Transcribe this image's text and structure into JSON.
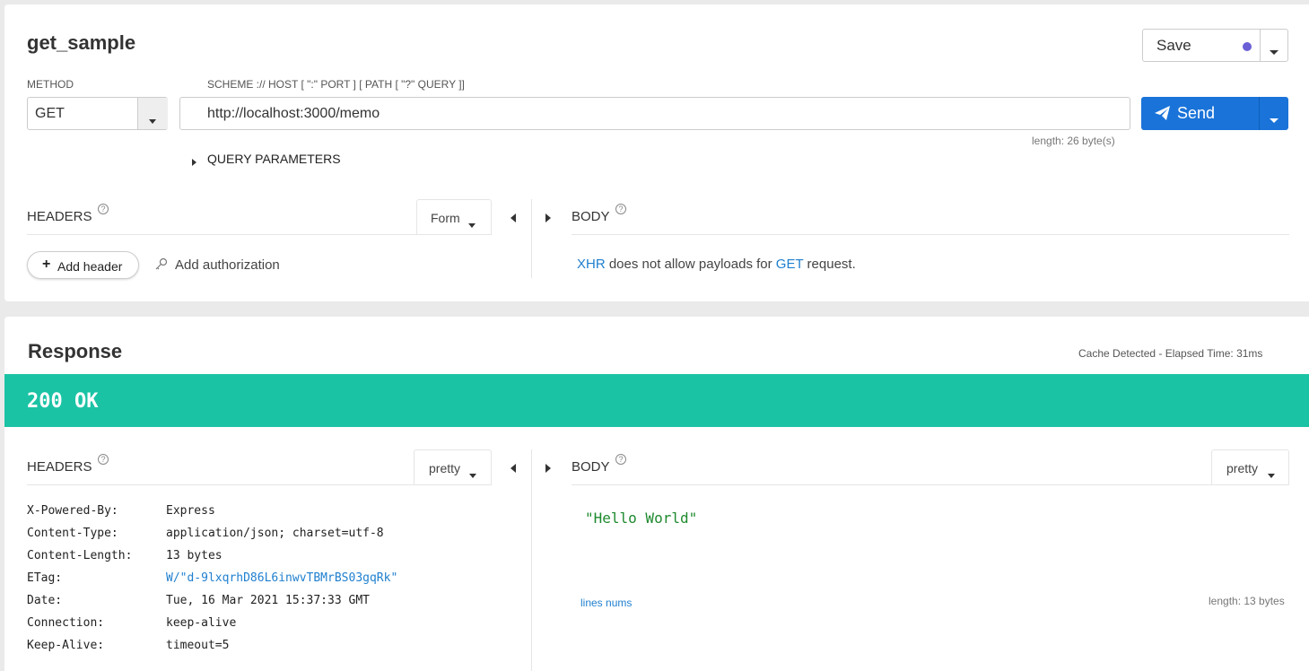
{
  "request": {
    "name": "get_sample",
    "save_label": "Save",
    "method_label": "METHOD",
    "method_value": "GET",
    "url_label": "SCHEME :// HOST [ \":\" PORT ] [ PATH [ \"?\" QUERY ]]",
    "url_value": "http://localhost:3000/memo",
    "url_length": "length: 26 byte(s)",
    "send_label": "Send",
    "query_params_label": "QUERY PARAMETERS",
    "headers": {
      "title": "HEADERS",
      "format": "Form",
      "add_header": "Add header",
      "add_authorization": "Add authorization"
    },
    "body": {
      "title": "BODY",
      "message_part1": "XHR",
      "message_part2": " does not allow payloads for ",
      "message_part3": "GET",
      "message_part4": " request."
    }
  },
  "response": {
    "title": "Response",
    "meta": "Cache Detected - Elapsed Time: 31ms",
    "status": "200 OK",
    "status_color": "#1bc3a5",
    "headers": {
      "title": "HEADERS",
      "format": "pretty",
      "rows": [
        {
          "key": "X-Powered-By:",
          "value": "Express",
          "is_link": false
        },
        {
          "key": "Content-Type:",
          "value": "application/json; charset=utf-8",
          "is_link": false
        },
        {
          "key": "Content-Length:",
          "value": "13 bytes",
          "is_link": false
        },
        {
          "key": "ETag:",
          "value": "W/\"d-9lxqrhD86L6inwvTBMrBS03gqRk\"",
          "is_link": true
        },
        {
          "key": "Date:",
          "value": "Tue, 16 Mar 2021 15:37:33 GMT",
          "is_link": false
        },
        {
          "key": "Connection:",
          "value": "keep-alive",
          "is_link": false
        },
        {
          "key": "Keep-Alive:",
          "value": "timeout=5",
          "is_link": false
        }
      ]
    },
    "body": {
      "title": "BODY",
      "format": "pretty",
      "content": "\"Hello World\"",
      "lines_nums": "lines nums",
      "length": "length: 13 bytes"
    }
  },
  "colors": {
    "accent": "#1a73d9",
    "save_dot": "#6b5fd6",
    "link": "#1f7fcf",
    "body_string": "#1e8a2e"
  }
}
